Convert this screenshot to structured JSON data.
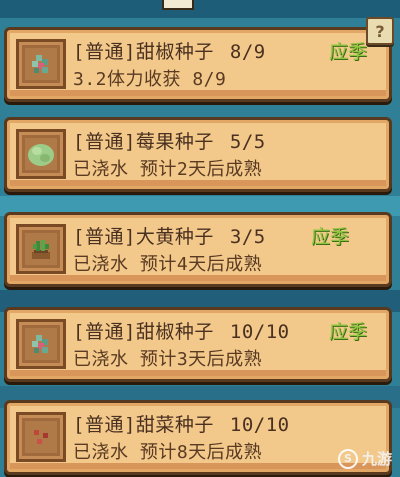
{
  "help_label": "?",
  "cards": [
    {
      "name": "[普通]甜椒种子",
      "count": "8/9",
      "season": "应季",
      "status": "3.2体力收获 8/9",
      "icon": "pepper-seed-icon"
    },
    {
      "name": "[普通]莓果种子",
      "count": "5/5",
      "season": "",
      "status": "已浇水 预计2天后成熟",
      "icon": "berry-bush-icon"
    },
    {
      "name": "[普通]大黄种子",
      "count": "3/5",
      "season": "应季",
      "status": "已浇水 预计4天后成熟",
      "icon": "rhubarb-sprout-icon"
    },
    {
      "name": "[普通]甜椒种子",
      "count": "10/10",
      "season": "应季",
      "status": "已浇水 预计3天后成熟",
      "icon": "pepper-seed-icon"
    },
    {
      "name": "[普通]甜菜种子",
      "count": "10/10",
      "season": "",
      "status": "已浇水 预计8天后成熟",
      "icon": "beet-seed-icon"
    }
  ],
  "watermark": "九游",
  "colors": {
    "card": "#f2c98b",
    "border": "#5a3a1e",
    "season": "#8ec63f",
    "background": "#2f7f96"
  }
}
